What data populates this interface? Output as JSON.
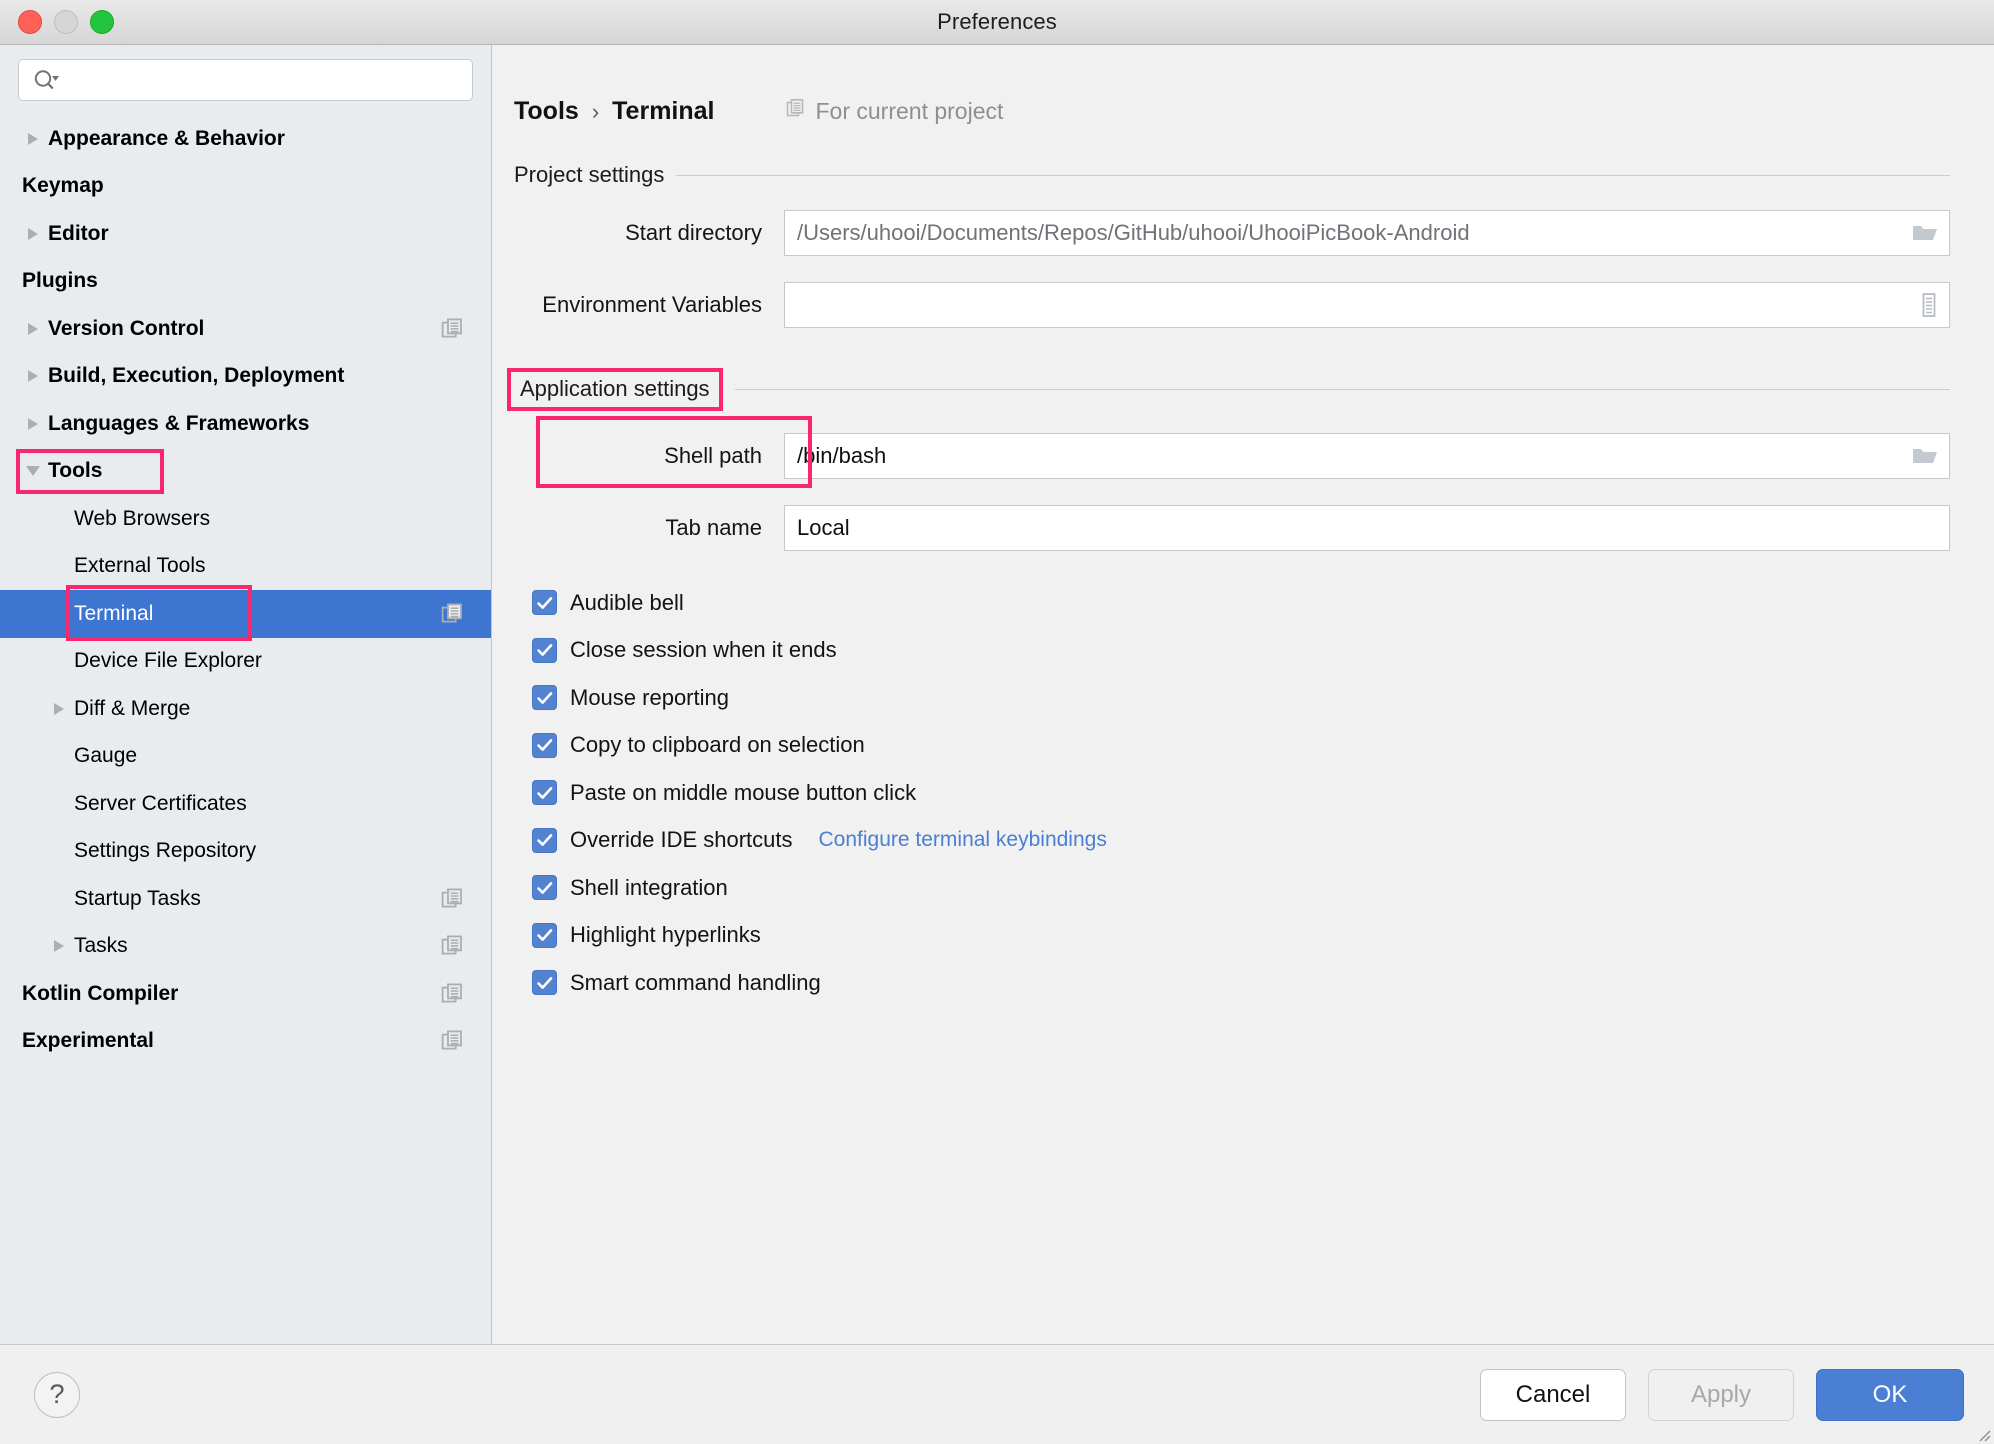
{
  "window": {
    "title": "Preferences",
    "traffic_lights": [
      "close",
      "minimize",
      "zoom"
    ]
  },
  "sidebar": {
    "search": {
      "placeholder": "",
      "value": ""
    },
    "items": [
      {
        "label": "Appearance & Behavior",
        "level": 0,
        "arrow": "right",
        "bold": true,
        "badge": false,
        "selected": false
      },
      {
        "label": "Keymap",
        "level": 0,
        "arrow": "none",
        "bold": true,
        "badge": false,
        "selected": false
      },
      {
        "label": "Editor",
        "level": 0,
        "arrow": "right",
        "bold": true,
        "badge": false,
        "selected": false
      },
      {
        "label": "Plugins",
        "level": 0,
        "arrow": "none",
        "bold": true,
        "badge": false,
        "selected": false
      },
      {
        "label": "Version Control",
        "level": 0,
        "arrow": "right",
        "bold": true,
        "badge": true,
        "selected": false
      },
      {
        "label": "Build, Execution, Deployment",
        "level": 0,
        "arrow": "right",
        "bold": true,
        "badge": false,
        "selected": false
      },
      {
        "label": "Languages & Frameworks",
        "level": 0,
        "arrow": "right",
        "bold": true,
        "badge": false,
        "selected": false
      },
      {
        "label": "Tools",
        "level": 0,
        "arrow": "down",
        "bold": true,
        "badge": false,
        "selected": false,
        "highlight": true
      },
      {
        "label": "Web Browsers",
        "level": 1,
        "arrow": "none",
        "bold": false,
        "badge": false,
        "selected": false
      },
      {
        "label": "External Tools",
        "level": 1,
        "arrow": "none",
        "bold": false,
        "badge": false,
        "selected": false
      },
      {
        "label": "Terminal",
        "level": 1,
        "arrow": "none",
        "bold": false,
        "badge": true,
        "selected": true,
        "highlight": true
      },
      {
        "label": "Device File Explorer",
        "level": 1,
        "arrow": "none",
        "bold": false,
        "badge": false,
        "selected": false
      },
      {
        "label": "Diff & Merge",
        "level": 1,
        "arrow": "right",
        "bold": false,
        "badge": false,
        "selected": false
      },
      {
        "label": "Gauge",
        "level": 1,
        "arrow": "none",
        "bold": false,
        "badge": false,
        "selected": false
      },
      {
        "label": "Server Certificates",
        "level": 1,
        "arrow": "none",
        "bold": false,
        "badge": false,
        "selected": false
      },
      {
        "label": "Settings Repository",
        "level": 1,
        "arrow": "none",
        "bold": false,
        "badge": false,
        "selected": false
      },
      {
        "label": "Startup Tasks",
        "level": 1,
        "arrow": "none",
        "bold": false,
        "badge": true,
        "selected": false
      },
      {
        "label": "Tasks",
        "level": 1,
        "arrow": "right",
        "bold": false,
        "badge": true,
        "selected": false
      },
      {
        "label": "Kotlin Compiler",
        "level": 0,
        "arrow": "none",
        "bold": true,
        "badge": true,
        "selected": false
      },
      {
        "label": "Experimental",
        "level": 0,
        "arrow": "none",
        "bold": true,
        "badge": true,
        "selected": false
      }
    ]
  },
  "main": {
    "breadcrumb": {
      "parent": "Tools",
      "separator": "›",
      "current": "Terminal"
    },
    "for_current_project": "For current project",
    "project_settings": {
      "section_title": "Project settings",
      "start_directory": {
        "label": "Start directory",
        "value": "/Users/uhooi/Documents/Repos/GitHub/uhooi/UhooiPicBook-Android",
        "trailing_icon": "folder-icon"
      },
      "environment_variables": {
        "label": "Environment Variables",
        "value": "",
        "trailing_icon": "list-icon"
      }
    },
    "application_settings": {
      "section_title": "Application settings",
      "shell_path": {
        "label": "Shell path",
        "value": "/bin/bash",
        "trailing_icon": "folder-icon"
      },
      "tab_name": {
        "label": "Tab name",
        "value": "Local"
      },
      "checkboxes": [
        {
          "label": "Audible bell",
          "checked": true
        },
        {
          "label": "Close session when it ends",
          "checked": true
        },
        {
          "label": "Mouse reporting",
          "checked": true
        },
        {
          "label": "Copy to clipboard on selection",
          "checked": true
        },
        {
          "label": "Paste on middle mouse button click",
          "checked": true
        },
        {
          "label": "Override IDE shortcuts",
          "checked": true,
          "link": "Configure terminal keybindings"
        },
        {
          "label": "Shell integration",
          "checked": true
        },
        {
          "label": "Highlight hyperlinks",
          "checked": true
        },
        {
          "label": "Smart command handling",
          "checked": true
        }
      ]
    }
  },
  "footer": {
    "help_label": "?",
    "cancel_label": "Cancel",
    "apply_label": "Apply",
    "ok_label": "OK"
  },
  "colors": {
    "annotation": "#f9286e",
    "selection": "#3d75d0",
    "accent": "#4a7fd4",
    "checkbox": "#5183d0",
    "link": "#4a7fd4",
    "sidebar_bg": "#e8ecef",
    "main_bg": "#f1f1f1"
  }
}
